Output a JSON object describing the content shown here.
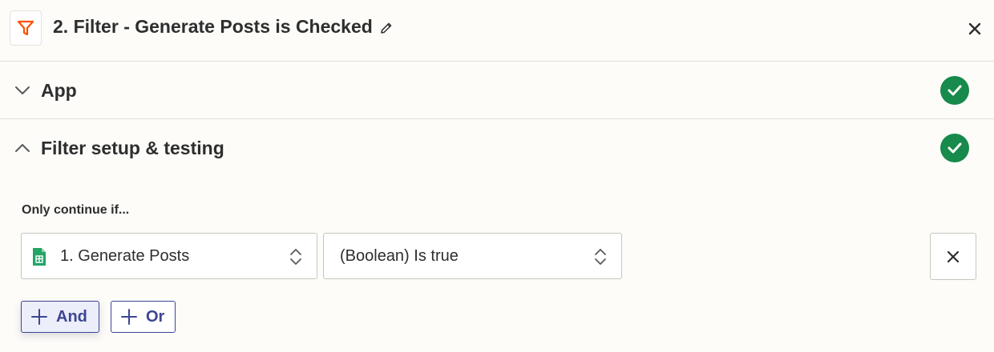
{
  "header": {
    "title": "2. Filter - Generate Posts is Checked",
    "icons": {
      "app": "filter-icon",
      "edit": "pencil-icon",
      "close": "close-icon"
    },
    "accent_color": "#ff4f00"
  },
  "sections": {
    "app": {
      "label": "App",
      "state": "collapsed",
      "status": "complete"
    },
    "filter": {
      "label": "Filter setup & testing",
      "state": "expanded",
      "status": "complete"
    }
  },
  "status_color": "#178a4c",
  "filter": {
    "condition_label": "Only continue if...",
    "field_value": "1. Generate Posts",
    "field_icon": "google-sheets-icon",
    "operator_value": "(Boolean) Is true",
    "and_label": "And",
    "or_label": "Or"
  },
  "button_color": "#3d4592"
}
